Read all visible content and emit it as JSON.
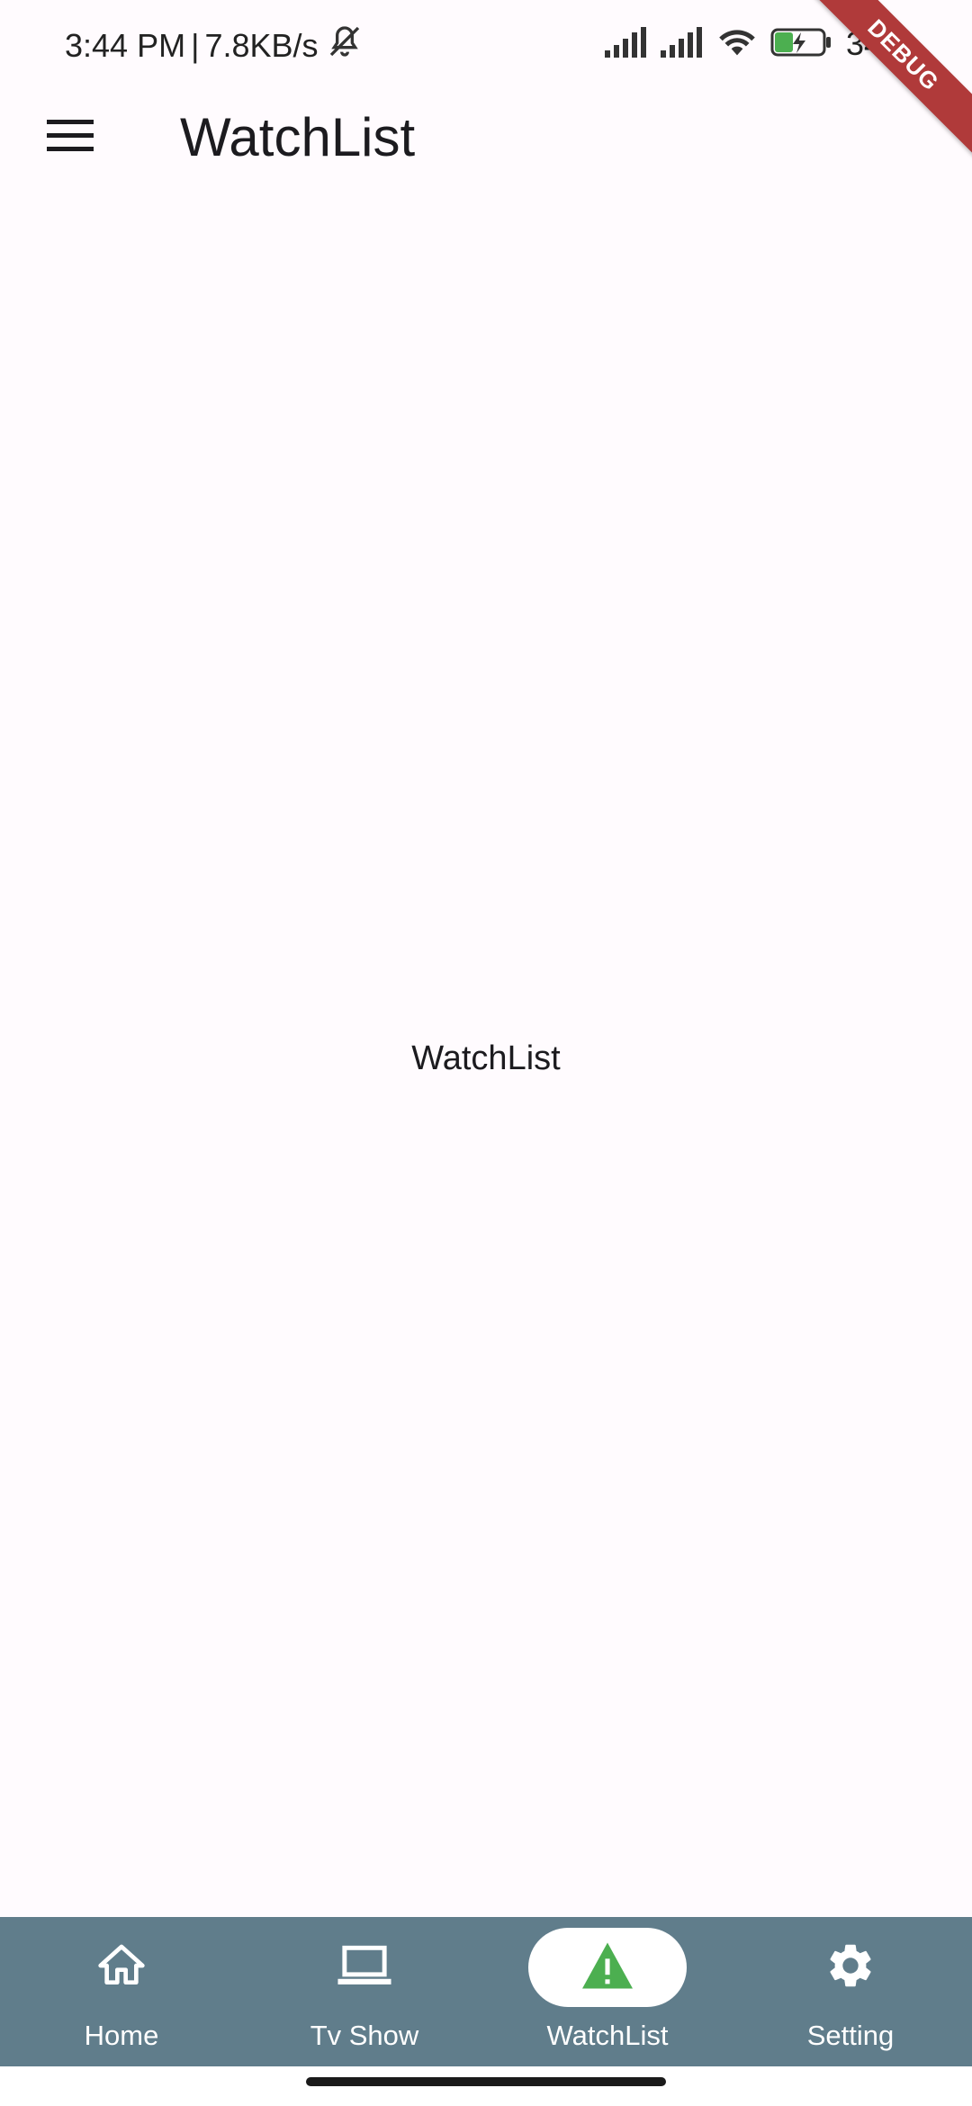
{
  "status_bar": {
    "time": "3:44 PM",
    "separator": "|",
    "speed": "7.8KB/s",
    "battery": "34",
    "icons": [
      "mute-bell-icon",
      "signal-icon",
      "signal-icon",
      "wifi-icon",
      "battery-charging-icon"
    ]
  },
  "debug_banner": "DEBUG",
  "app_bar": {
    "menu_icon": "hamburger-menu-icon",
    "title": "WatchList"
  },
  "body": {
    "text": "WatchList"
  },
  "bottom_nav": {
    "selected": "WatchList",
    "items": [
      {
        "label": "Home",
        "icon": "home-icon"
      },
      {
        "label": "Tv Show",
        "icon": "laptop-icon"
      },
      {
        "label": "WatchList",
        "icon": "warning-icon"
      },
      {
        "label": "Setting",
        "icon": "gear-icon"
      }
    ]
  },
  "colors": {
    "nav_background": "#607d8b",
    "accent": "#4caf50",
    "debug_ribbon": "#b03a3a",
    "page_background": "#fffbfe"
  }
}
